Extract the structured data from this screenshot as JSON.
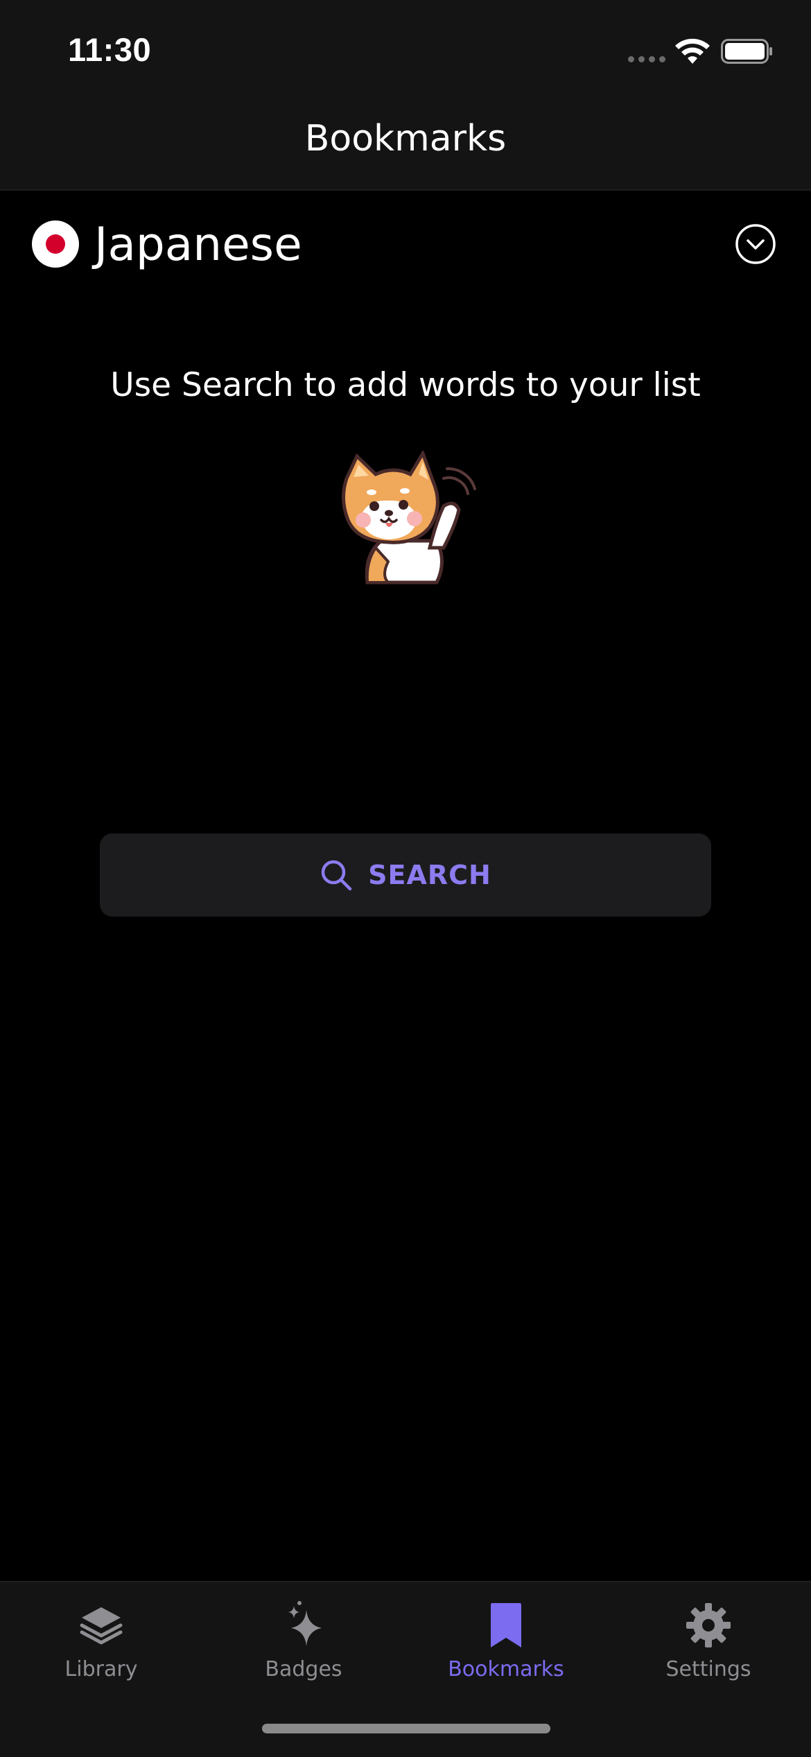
{
  "status_bar": {
    "time": "11:30"
  },
  "header": {
    "title": "Bookmarks"
  },
  "language": {
    "name": "Japanese",
    "flag_icon": "japan-flag-icon",
    "toggle_icon": "chevron-down-circle-icon"
  },
  "empty_state": {
    "message": "Use Search to add words to your list",
    "illustration": "shiba-inu-waving"
  },
  "search_button": {
    "label": "SEARCH",
    "icon": "search-icon"
  },
  "tabs": [
    {
      "label": "Library",
      "icon": "layers-icon",
      "active": false
    },
    {
      "label": "Badges",
      "icon": "sparkles-icon",
      "active": false
    },
    {
      "label": "Bookmarks",
      "icon": "bookmark-icon",
      "active": true
    },
    {
      "label": "Settings",
      "icon": "gear-icon",
      "active": false
    }
  ],
  "colors": {
    "accent": "#7b6cf0",
    "background": "#000000",
    "bar_background": "#141414",
    "inactive_tab": "#8e8e93",
    "flag_red": "#d3002c"
  }
}
